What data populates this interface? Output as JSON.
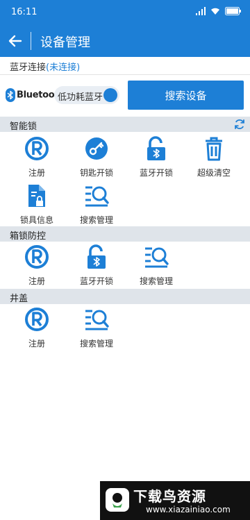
{
  "status_bar": {
    "time": "16:11"
  },
  "app_bar": {
    "title": "设备管理"
  },
  "connection": {
    "label": "蓝牙连接",
    "state": "(未连接)"
  },
  "bluetooth": {
    "brand": "Bluetooth",
    "mark": "®",
    "mode_label": "低功耗蓝牙",
    "search_button": "搜索设备"
  },
  "sections": [
    {
      "name": "智能锁",
      "items": [
        {
          "label": "注册",
          "icon": "registered-icon"
        },
        {
          "label": "钥匙开锁",
          "icon": "key-icon"
        },
        {
          "label": "蓝牙开锁",
          "icon": "bluetooth-unlock-icon"
        },
        {
          "label": "超级清空",
          "icon": "trash-icon"
        },
        {
          "label": "锁具信息",
          "icon": "lock-info-icon"
        },
        {
          "label": "搜索管理",
          "icon": "search-manage-icon"
        }
      ]
    },
    {
      "name": "箱锁防控",
      "items": [
        {
          "label": "注册",
          "icon": "registered-icon"
        },
        {
          "label": "蓝牙开锁",
          "icon": "bluetooth-unlock-icon"
        },
        {
          "label": "搜索管理",
          "icon": "search-manage-icon"
        }
      ]
    },
    {
      "name": "井盖",
      "items": [
        {
          "label": "注册",
          "icon": "registered-icon"
        },
        {
          "label": "搜索管理",
          "icon": "search-manage-icon"
        }
      ]
    }
  ],
  "watermark": {
    "title": "下载鸟资源",
    "url": "www.xiazainiao.com"
  },
  "colors": {
    "primary": "#1d7fd6",
    "section_bg": "#dfe4ea",
    "text": "#333333"
  }
}
